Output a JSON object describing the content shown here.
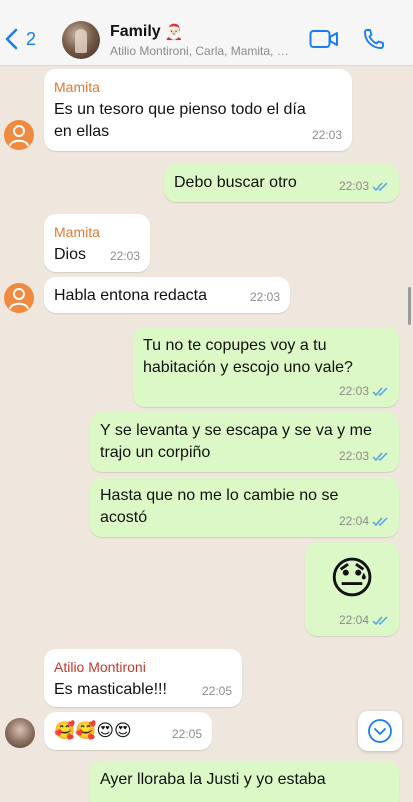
{
  "header": {
    "back_count": "2",
    "title": "Family",
    "title_emoji": "🎅🏻",
    "subtitle": "Atilio Montironi, Carla, Mamita, …"
  },
  "colors": {
    "mamita": "#e07a2f",
    "atilio": "#c0392b",
    "ticks": "#4fa3e6",
    "accent": "#1a7cf2"
  },
  "messages": [
    {
      "sender": "Mamita",
      "text": "Es un tesoro que pienso todo el día en ellas",
      "time": "22:03",
      "direction": "in"
    },
    {
      "text": "Debo buscar otro",
      "time": "22:03",
      "direction": "out",
      "read": true
    },
    {
      "sender": "Mamita",
      "text": "Dios",
      "time": "22:03",
      "direction": "in"
    },
    {
      "text": "Habla entona redacta",
      "time": "22:03",
      "direction": "in"
    },
    {
      "text": "Tu no te copupes voy a tu habitación y escojo uno vale?",
      "time": "22:03",
      "direction": "out",
      "read": true
    },
    {
      "text": "Y se levanta y se escapa y se va y me trajo un corpiño",
      "time": "22:03",
      "direction": "out",
      "read": true
    },
    {
      "text": "Hasta que no me lo cambie no se acostó",
      "time": "22:04",
      "direction": "out",
      "read": true
    },
    {
      "text": "😓",
      "time": "22:04",
      "direction": "out",
      "read": true
    },
    {
      "sender": "Atilio Montironi",
      "text": "Es masticable!!!",
      "time": "22:05",
      "direction": "in"
    },
    {
      "text": "🥰🥰😍😍",
      "time": "22:05",
      "direction": "in"
    },
    {
      "text": "Ayer lloraba la Justi y yo estaba",
      "direction": "out"
    }
  ],
  "icons": {
    "back": "chevron-left-icon",
    "video": "video-camera-icon",
    "call": "phone-icon",
    "scroll": "chevron-down-icon",
    "default_avatar": "person-icon"
  }
}
